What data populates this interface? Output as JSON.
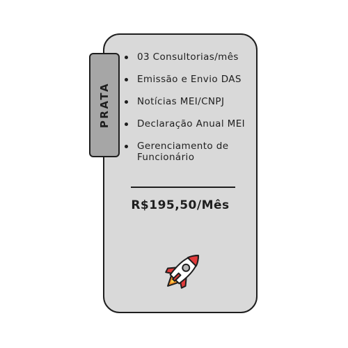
{
  "plan": {
    "tier_label": "PRATA",
    "features": [
      "03 Consultorias/mês",
      "Emissão e Envio DAS",
      "Notícias MEI/CNPJ",
      "Declaração Anual MEI",
      "Gerenciamento de Funcionário"
    ],
    "price": "R$195,50/Mês",
    "icon": "rocket-icon"
  },
  "colors": {
    "card_background": "#d9d9d9",
    "tag_background": "#a6a6a6",
    "outline": "#1e1e1e"
  }
}
